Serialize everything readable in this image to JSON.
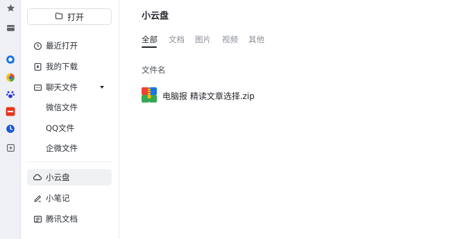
{
  "rail": {
    "icons": [
      "star-icon",
      "folder-icon",
      "qq-browser-icon",
      "colorful-app-icon",
      "baidu-paw-icon",
      "red-app-icon",
      "clock-app-icon",
      "add-box-icon"
    ]
  },
  "sidebar": {
    "open_label": "打开",
    "recent": "最近打开",
    "downloads": "我的下载",
    "chat_files": "聊天文件",
    "wechat_files": "微信文件",
    "qq_files": "QQ文件",
    "wecom_files": "企微文件",
    "cloud": "小云盘",
    "notes": "小笔记",
    "tencent_docs": "腾讯文档"
  },
  "main": {
    "title": "小云盘",
    "tabs": [
      "全部",
      "文档",
      "图片",
      "视频",
      "其他"
    ],
    "active_tab": "全部",
    "column_header": "文件名",
    "files": [
      {
        "name": "电脑报 精读文章选择.zip",
        "icon": "zip-archive-icon"
      }
    ]
  },
  "colors": {
    "rail_bg": "#eef0f3",
    "active_item_bg": "#f0f1f3",
    "text_primary": "#1f2329",
    "text_muted": "#8a8f99"
  }
}
